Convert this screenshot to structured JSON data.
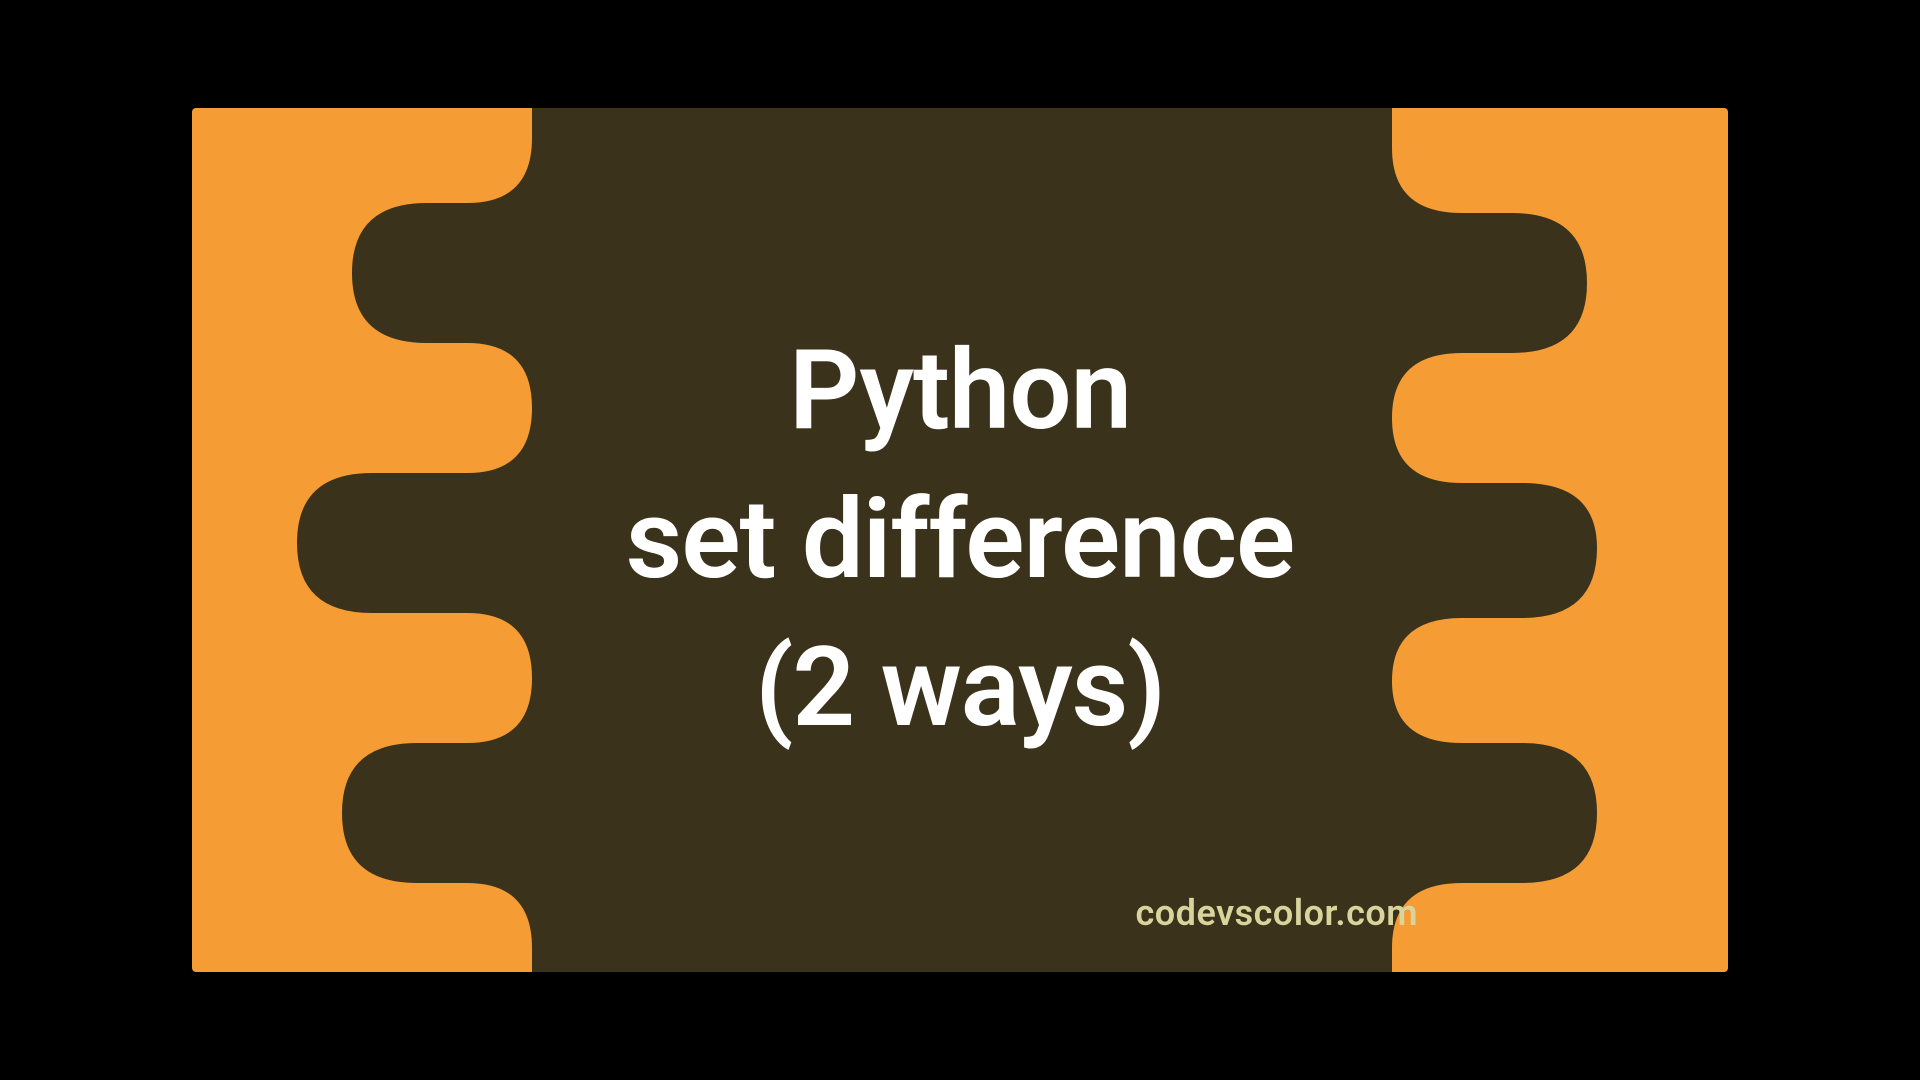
{
  "colors": {
    "background": "#f59d34",
    "blob": "#3b321c",
    "title": "#ffffff",
    "watermark": "#d8d49c"
  },
  "title": {
    "line1": "Python",
    "line2": "set difference",
    "line3": "(2 ways)"
  },
  "watermark": "codevscolor.com"
}
